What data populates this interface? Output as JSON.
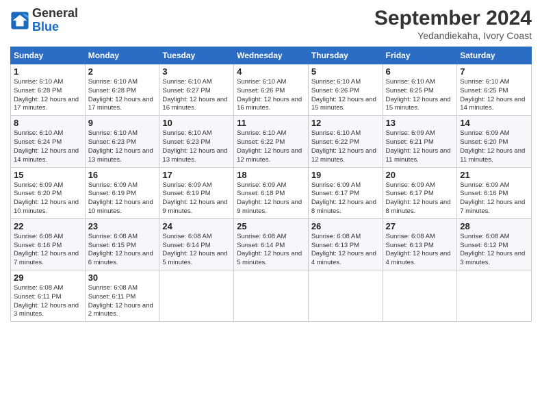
{
  "header": {
    "logo_text_general": "General",
    "logo_text_blue": "Blue",
    "month_title": "September 2024",
    "location": "Yedandiekaha, Ivory Coast"
  },
  "days_of_week": [
    "Sunday",
    "Monday",
    "Tuesday",
    "Wednesday",
    "Thursday",
    "Friday",
    "Saturday"
  ],
  "weeks": [
    [
      {
        "day": "1",
        "sunrise": "6:10 AM",
        "sunset": "6:28 PM",
        "daylight": "12 hours and 17 minutes."
      },
      {
        "day": "2",
        "sunrise": "6:10 AM",
        "sunset": "6:28 PM",
        "daylight": "12 hours and 17 minutes."
      },
      {
        "day": "3",
        "sunrise": "6:10 AM",
        "sunset": "6:27 PM",
        "daylight": "12 hours and 16 minutes."
      },
      {
        "day": "4",
        "sunrise": "6:10 AM",
        "sunset": "6:26 PM",
        "daylight": "12 hours and 16 minutes."
      },
      {
        "day": "5",
        "sunrise": "6:10 AM",
        "sunset": "6:26 PM",
        "daylight": "12 hours and 15 minutes."
      },
      {
        "day": "6",
        "sunrise": "6:10 AM",
        "sunset": "6:25 PM",
        "daylight": "12 hours and 15 minutes."
      },
      {
        "day": "7",
        "sunrise": "6:10 AM",
        "sunset": "6:25 PM",
        "daylight": "12 hours and 14 minutes."
      }
    ],
    [
      {
        "day": "8",
        "sunrise": "6:10 AM",
        "sunset": "6:24 PM",
        "daylight": "12 hours and 14 minutes."
      },
      {
        "day": "9",
        "sunrise": "6:10 AM",
        "sunset": "6:23 PM",
        "daylight": "12 hours and 13 minutes."
      },
      {
        "day": "10",
        "sunrise": "6:10 AM",
        "sunset": "6:23 PM",
        "daylight": "12 hours and 13 minutes."
      },
      {
        "day": "11",
        "sunrise": "6:10 AM",
        "sunset": "6:22 PM",
        "daylight": "12 hours and 12 minutes."
      },
      {
        "day": "12",
        "sunrise": "6:10 AM",
        "sunset": "6:22 PM",
        "daylight": "12 hours and 12 minutes."
      },
      {
        "day": "13",
        "sunrise": "6:09 AM",
        "sunset": "6:21 PM",
        "daylight": "12 hours and 11 minutes."
      },
      {
        "day": "14",
        "sunrise": "6:09 AM",
        "sunset": "6:20 PM",
        "daylight": "12 hours and 11 minutes."
      }
    ],
    [
      {
        "day": "15",
        "sunrise": "6:09 AM",
        "sunset": "6:20 PM",
        "daylight": "12 hours and 10 minutes."
      },
      {
        "day": "16",
        "sunrise": "6:09 AM",
        "sunset": "6:19 PM",
        "daylight": "12 hours and 10 minutes."
      },
      {
        "day": "17",
        "sunrise": "6:09 AM",
        "sunset": "6:19 PM",
        "daylight": "12 hours and 9 minutes."
      },
      {
        "day": "18",
        "sunrise": "6:09 AM",
        "sunset": "6:18 PM",
        "daylight": "12 hours and 9 minutes."
      },
      {
        "day": "19",
        "sunrise": "6:09 AM",
        "sunset": "6:17 PM",
        "daylight": "12 hours and 8 minutes."
      },
      {
        "day": "20",
        "sunrise": "6:09 AM",
        "sunset": "6:17 PM",
        "daylight": "12 hours and 8 minutes."
      },
      {
        "day": "21",
        "sunrise": "6:09 AM",
        "sunset": "6:16 PM",
        "daylight": "12 hours and 7 minutes."
      }
    ],
    [
      {
        "day": "22",
        "sunrise": "6:08 AM",
        "sunset": "6:16 PM",
        "daylight": "12 hours and 7 minutes."
      },
      {
        "day": "23",
        "sunrise": "6:08 AM",
        "sunset": "6:15 PM",
        "daylight": "12 hours and 6 minutes."
      },
      {
        "day": "24",
        "sunrise": "6:08 AM",
        "sunset": "6:14 PM",
        "daylight": "12 hours and 5 minutes."
      },
      {
        "day": "25",
        "sunrise": "6:08 AM",
        "sunset": "6:14 PM",
        "daylight": "12 hours and 5 minutes."
      },
      {
        "day": "26",
        "sunrise": "6:08 AM",
        "sunset": "6:13 PM",
        "daylight": "12 hours and 4 minutes."
      },
      {
        "day": "27",
        "sunrise": "6:08 AM",
        "sunset": "6:13 PM",
        "daylight": "12 hours and 4 minutes."
      },
      {
        "day": "28",
        "sunrise": "6:08 AM",
        "sunset": "6:12 PM",
        "daylight": "12 hours and 3 minutes."
      }
    ],
    [
      {
        "day": "29",
        "sunrise": "6:08 AM",
        "sunset": "6:11 PM",
        "daylight": "12 hours and 3 minutes."
      },
      {
        "day": "30",
        "sunrise": "6:08 AM",
        "sunset": "6:11 PM",
        "daylight": "12 hours and 2 minutes."
      },
      null,
      null,
      null,
      null,
      null
    ]
  ]
}
